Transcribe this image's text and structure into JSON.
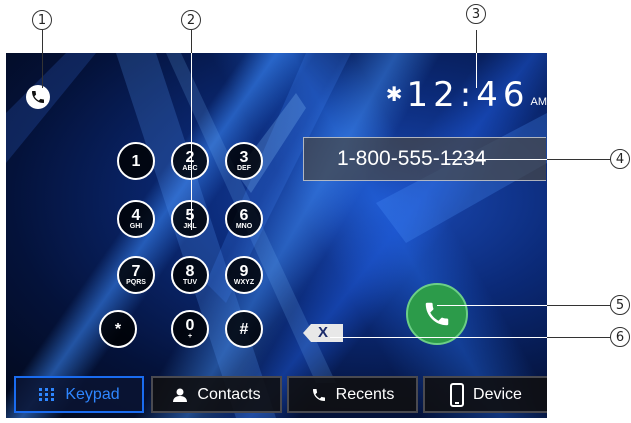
{
  "status": {
    "bluetooth_icon": "bluetooth-icon",
    "time": "12:46",
    "ampm": "AM"
  },
  "header": {
    "phone_mode_icon": "phone-icon"
  },
  "dial_display": {
    "number": "1-800-555-1234"
  },
  "keypad": {
    "keys": [
      {
        "digit": "1",
        "letters": ""
      },
      {
        "digit": "2",
        "letters": "ABC"
      },
      {
        "digit": "3",
        "letters": "DEF"
      },
      {
        "digit": "4",
        "letters": "GHI"
      },
      {
        "digit": "5",
        "letters": "JKL"
      },
      {
        "digit": "6",
        "letters": "MNO"
      },
      {
        "digit": "7",
        "letters": "PQRS"
      },
      {
        "digit": "8",
        "letters": "TUV"
      },
      {
        "digit": "9",
        "letters": "WXYZ"
      },
      {
        "digit": "*",
        "letters": ""
      },
      {
        "digit": "0",
        "letters": "+"
      },
      {
        "digit": "#",
        "letters": ""
      }
    ]
  },
  "actions": {
    "call_icon": "phone-icon",
    "backspace_icon": "backspace-icon",
    "backspace_label": "X"
  },
  "tabs": [
    {
      "label": "Keypad",
      "icon": "keypad-icon",
      "active": true
    },
    {
      "label": "Contacts",
      "icon": "person-icon",
      "active": false
    },
    {
      "label": "Recents",
      "icon": "phone-icon",
      "active": false
    },
    {
      "label": "Device",
      "icon": "mobile-device-icon",
      "active": false
    }
  ],
  "callouts": [
    "1",
    "2",
    "3",
    "4",
    "5",
    "6"
  ],
  "colors": {
    "accent_blue": "#1a6cf0",
    "call_green": "#2c9b4a",
    "background_navy": "#0b2a78"
  }
}
